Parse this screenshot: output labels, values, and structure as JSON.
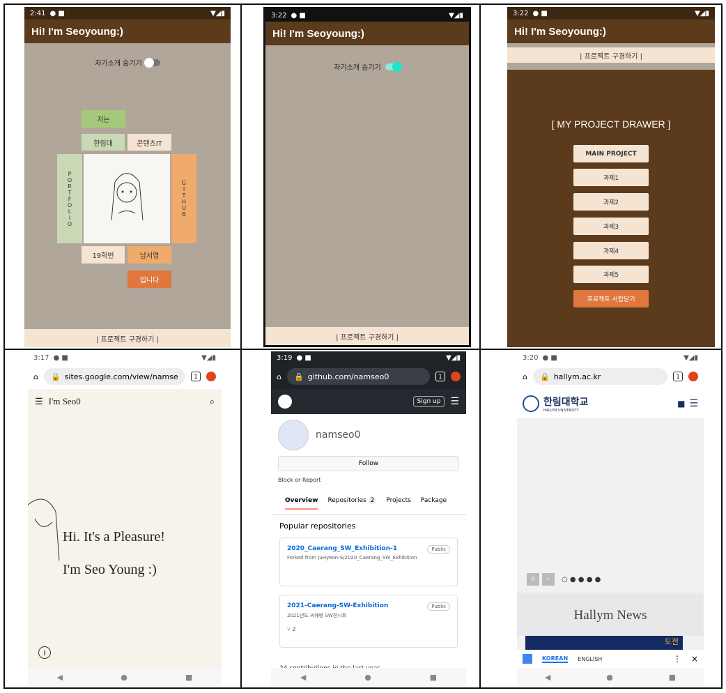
{
  "status": {
    "p1": "2:41",
    "p2": "3:22",
    "p3": "3:22",
    "p4": "3:17",
    "p5": "3:19",
    "p6": "3:20"
  },
  "app": {
    "title": "Hi! I'm Seoyoung:)"
  },
  "p1": {
    "toggle_label": "자기소개 숨기기",
    "btn_me": "저는",
    "btn_hallym": "한림대",
    "btn_content": "콘텐츠IT",
    "portfolio": [
      "P",
      "O",
      "R",
      "T",
      "F",
      "O",
      "L",
      "I",
      "O"
    ],
    "github": [
      "G",
      "I",
      "T",
      "H",
      "U",
      "B"
    ],
    "btn_id": "19학번",
    "btn_name": "남서영",
    "btn_end": "입니다",
    "bottom": "| 프로젝트 구경하기 |"
  },
  "p2": {
    "toggle_label": "자기소개 숨기기",
    "bottom": "| 프로젝트 구경하기 |"
  },
  "p3": {
    "top": "| 프로젝트 구경하기 |",
    "drawer_title": "[ MY PROJECT DRAWER ]",
    "items": [
      "MAIN PROJECT",
      "과제1",
      "과제2",
      "과제3",
      "과제4",
      "과제5"
    ],
    "close": "프로젝트 서랍닫기"
  },
  "p4": {
    "url": "sites.google.com/view/namse",
    "tabs": "1",
    "site_title": "I'm Seo0",
    "line1": "Hi. It's a Pleasure!",
    "line2": "I'm Seo Young :)"
  },
  "p5": {
    "url": "github.com/namseo0",
    "tabs": "1",
    "signup": "Sign up",
    "user": "namseo0",
    "follow": "Follow",
    "block": "Block or Report",
    "tabs_list": [
      "Overview",
      "Repositories",
      "Projects",
      "Package"
    ],
    "repo_count": "2",
    "popular": "Popular repositories",
    "repos": [
      {
        "name": "2020_Caerang_SW_Exhibition-1",
        "desc": "Forked from JuHyeon-S/2020_Caerang_SW_Exhibition",
        "badge": "Public"
      },
      {
        "name": "2021-Caerang-SW-Exhibition",
        "desc": "2021년도 씨애랑 SW전시회",
        "badge": "Public",
        "forks": "2"
      }
    ],
    "footer": "24 contributions in the last year"
  },
  "p6": {
    "url": "hallym.ac.kr",
    "tabs": "1",
    "logo_kr": "한림대학교",
    "logo_en": "HALLYM UNIVERSITY",
    "news": "Hallym News",
    "banner": "도전",
    "korean": "KOREAN",
    "english": "ENGLISH"
  },
  "colors": {
    "brown": "#5c3b1c",
    "gray": "#b1a69a",
    "cream": "#f5e4d2",
    "green": "#c9d9b5",
    "orange": "#f0aa6c",
    "burnt": "#e0773e",
    "teal": "#1ee3c9"
  }
}
